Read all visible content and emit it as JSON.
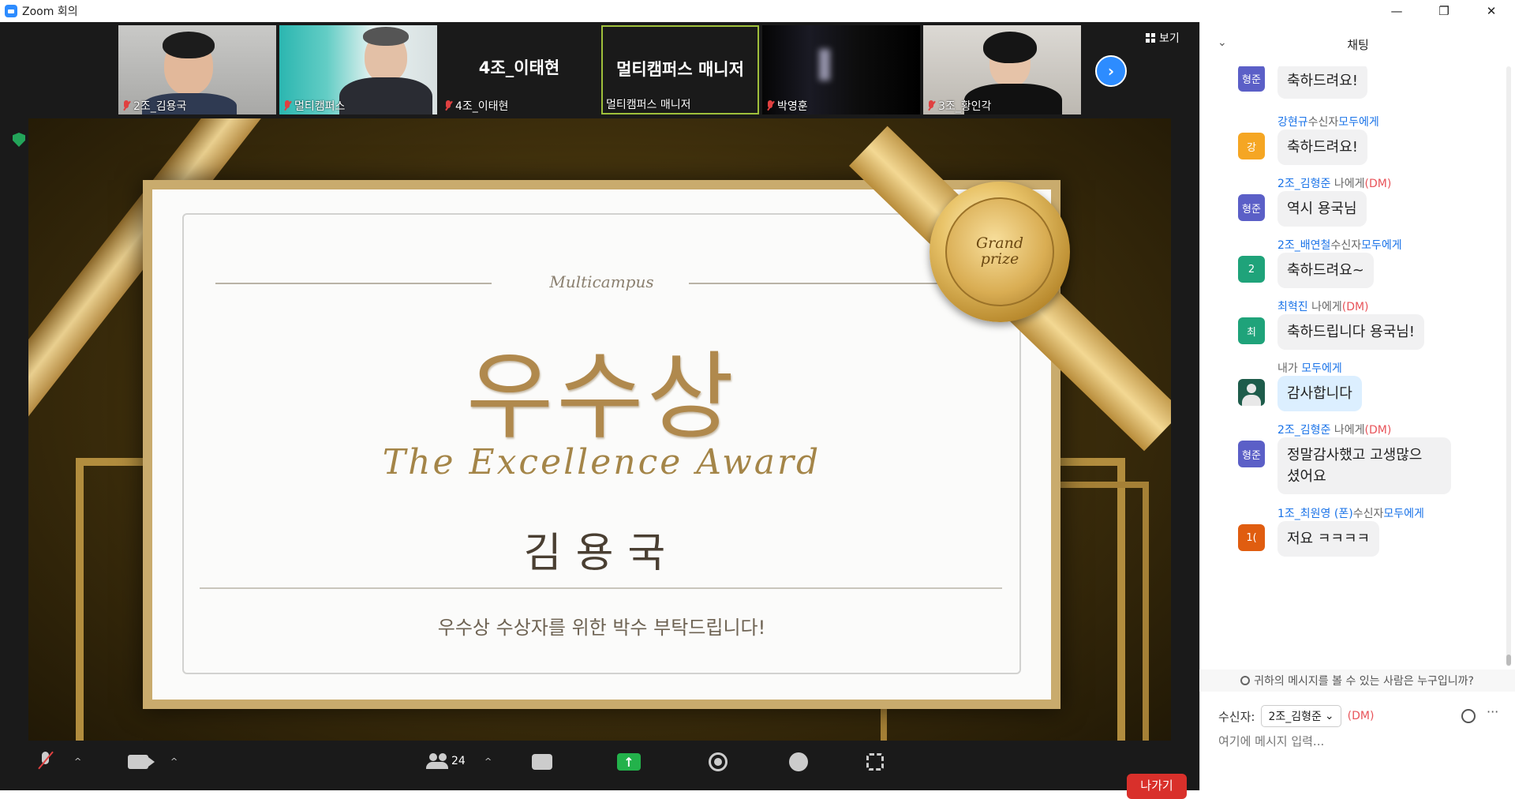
{
  "window": {
    "title": "Zoom 회의",
    "controls": [
      "—",
      "❐",
      "✕"
    ]
  },
  "strip": {
    "tiles": [
      {
        "name": "2조_김용국",
        "type": "video"
      },
      {
        "name": "멀티캠퍼스",
        "type": "video"
      },
      {
        "name": "4조_이태현",
        "center_name": "4조_이태현",
        "type": "name"
      },
      {
        "name": "멀티캠퍼스 매니저",
        "center_name": "멀티캠퍼스 매니저",
        "type": "name",
        "active": true
      },
      {
        "name": "박영훈",
        "type": "video"
      },
      {
        "name": "3조_황인각",
        "type": "video"
      }
    ],
    "next_icon": "chevron-right",
    "view_label": "보기"
  },
  "slide": {
    "brand": "Multicampus",
    "award_ko": "우수상",
    "award_en": "The Excellence Award",
    "winner": "김용국",
    "applause": "우수상 수상자를 위한 박수 부탁드립니다!",
    "medal_line1": "Grand",
    "medal_line2": "prize"
  },
  "toolbar": {
    "participants_count": "24",
    "leave_label": "나가기"
  },
  "chat": {
    "title": "채팅",
    "messages": [
      {
        "sender": "",
        "recipient": "",
        "avatar": "형준",
        "avatar_color": "#5b5fc7",
        "text": "축하드려요!",
        "partial": true
      },
      {
        "sender": "강현규",
        "via": "수신자",
        "recipient": "모두에게",
        "avatar": "강",
        "avatar_color": "#f5a623",
        "text": "축하드려요!"
      },
      {
        "sender": "2조_김형준",
        "via": "",
        "recipient": "나에게",
        "dm": "(DM)",
        "avatar": "형준",
        "avatar_color": "#5b5fc7",
        "text": "역시 용국님"
      },
      {
        "sender": "2조_배연철",
        "via": "수신자",
        "recipient": "모두에게",
        "avatar": "2",
        "avatar_color": "#1fa37a",
        "text": "축하드려요~"
      },
      {
        "sender": "최혁진",
        "via": "",
        "recipient": "나에게",
        "dm": "(DM)",
        "avatar": "최",
        "avatar_color": "#1fa37a",
        "text": "축하드립니다 용국님!"
      },
      {
        "sender": "내가",
        "via": "",
        "recipient": "모두에게",
        "avatar": "",
        "avatar_color": "#1e5c4b",
        "text": "감사합니다",
        "mine": true
      },
      {
        "sender": "2조_김형준",
        "via": "",
        "recipient": "나에게",
        "dm": "(DM)",
        "avatar": "형준",
        "avatar_color": "#5b5fc7",
        "text": "정말감사했고 고생많으\n셨어요"
      },
      {
        "sender": "1조_최원영 (폰)",
        "via": "수신자",
        "recipient": "모두에게",
        "avatar": "1(",
        "avatar_color": "#e05d10",
        "text": "저요 ㅋㅋㅋㅋ"
      }
    ],
    "privacy_text": "귀하의 메시지를 볼 수 있는 사람은 누구입니까?",
    "recipient_label": "수신자:",
    "recipient_value": "2조_김형준",
    "recipient_dm": "(DM)",
    "input_placeholder": "여기에 메시지 입력..."
  },
  "colors": {
    "zoom_blue": "#2d8cff",
    "leave_red": "#d9302b",
    "share_green": "#23b24b"
  }
}
